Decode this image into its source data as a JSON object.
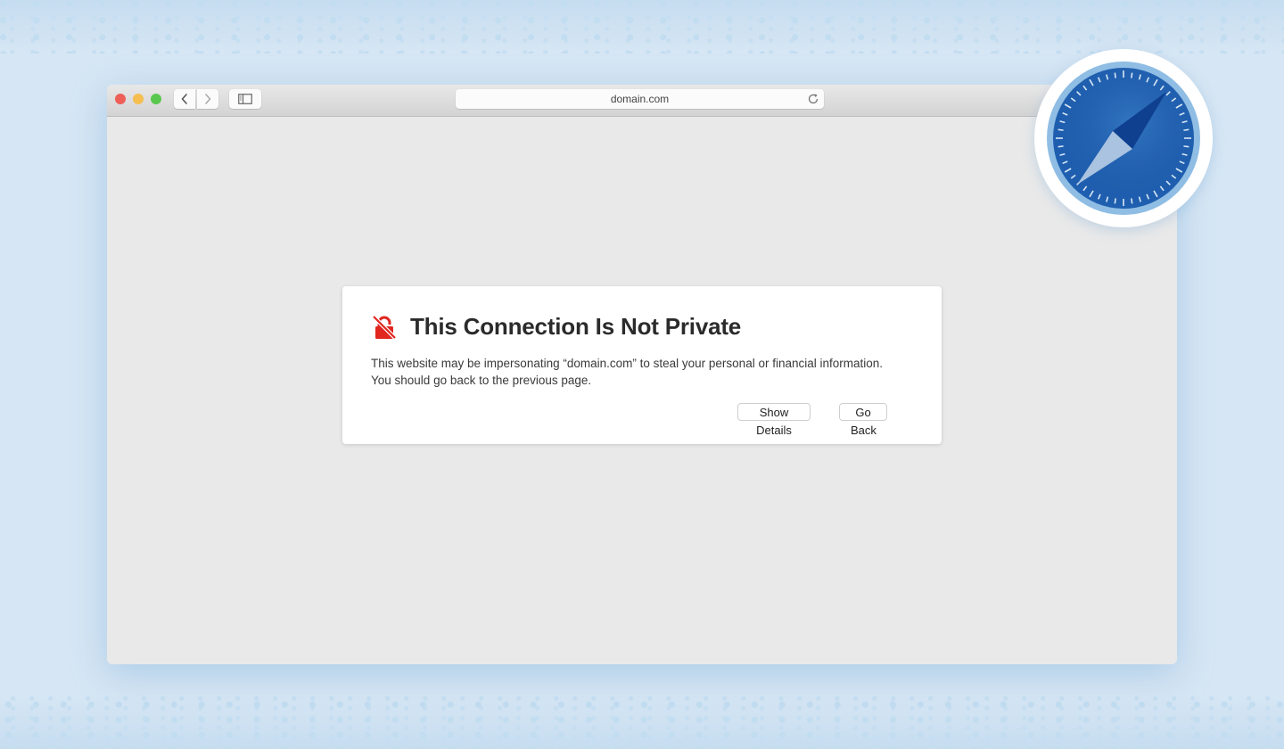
{
  "browser": {
    "address_bar": {
      "url": "domain.com"
    },
    "toolbar": {
      "back_icon": "chevron-left-icon",
      "forward_icon": "chevron-right-icon",
      "sidebar_icon": "sidebar-icon",
      "reload_icon": "reload-icon"
    },
    "traffic_lights": [
      "close",
      "minimize",
      "maximize"
    ]
  },
  "error_page": {
    "icon": "unlocked-padlock-slash-icon",
    "title": "This Connection Is Not Private",
    "message": "This website may be impersonating “domain.com” to steal your personal or financial information. You should go back to the previous page.",
    "buttons": {
      "show_details": "Show Details",
      "go_back": "Go Back"
    }
  },
  "badge": {
    "icon": "safari-compass-icon"
  },
  "colors": {
    "background": "#d6e6f4",
    "warning_red": "#e0261f",
    "safari_blue": "#1d5fb3",
    "close": "#ee5f57",
    "minimize": "#f5be4f",
    "maximize": "#5ac84f"
  }
}
